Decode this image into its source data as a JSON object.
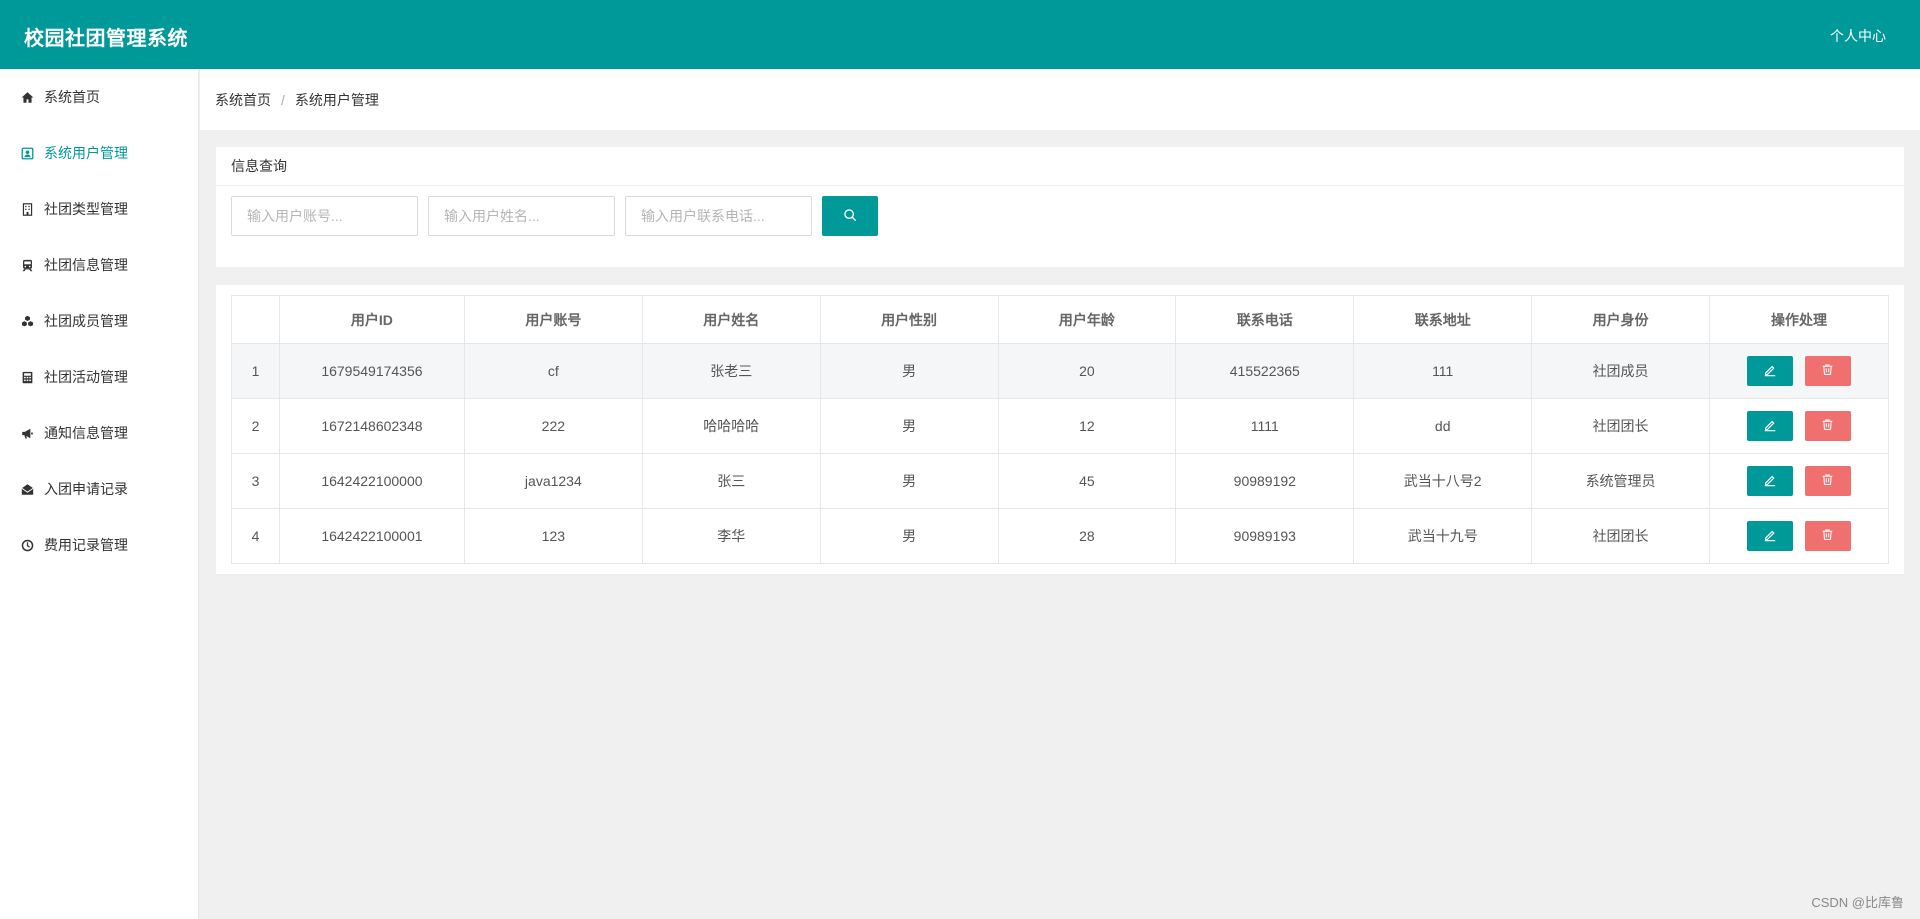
{
  "header": {
    "title": "校园社团管理系统",
    "user_center": "个人中心"
  },
  "sidebar": {
    "items": [
      {
        "label": "系统首页",
        "icon": "home-icon"
      },
      {
        "label": "系统用户管理",
        "icon": "user-card-icon",
        "active": true
      },
      {
        "label": "社团类型管理",
        "icon": "building-icon"
      },
      {
        "label": "社团信息管理",
        "icon": "train-icon"
      },
      {
        "label": "社团成员管理",
        "icon": "cubes-icon"
      },
      {
        "label": "社团活动管理",
        "icon": "calculator-icon"
      },
      {
        "label": "通知信息管理",
        "icon": "megaphone-icon"
      },
      {
        "label": "入团申请记录",
        "icon": "envelope-open-icon"
      },
      {
        "label": "费用记录管理",
        "icon": "clock-icon"
      }
    ]
  },
  "breadcrumb": {
    "home": "系统首页",
    "separator": "/",
    "current": "系统用户管理"
  },
  "query": {
    "title": "信息查询",
    "account_placeholder": "输入用户账号...",
    "name_placeholder": "输入用户姓名...",
    "phone_placeholder": "输入用户联系电话..."
  },
  "table": {
    "headers": [
      "",
      "用户ID",
      "用户账号",
      "用户姓名",
      "用户性别",
      "用户年龄",
      "联系电话",
      "联系地址",
      "用户身份",
      "操作处理"
    ],
    "rows": [
      [
        "1",
        "1679549174356",
        "cf",
        "张老三",
        "男",
        "20",
        "415522365",
        "111",
        "社团成员"
      ],
      [
        "2",
        "1672148602348",
        "222",
        "哈哈哈哈",
        "男",
        "12",
        "1111",
        "dd",
        "社团团长"
      ],
      [
        "3",
        "1642422100000",
        "java1234",
        "张三",
        "男",
        "45",
        "90989192",
        "武当十八号2",
        "系统管理员"
      ],
      [
        "4",
        "1642422100001",
        "123",
        "李华",
        "男",
        "28",
        "90989193",
        "武当十九号",
        "社团团长"
      ]
    ]
  },
  "watermark": "CSDN @比库鲁",
  "colors": {
    "primary": "#009999",
    "danger": "#f07070",
    "background": "#f0f0f0"
  }
}
